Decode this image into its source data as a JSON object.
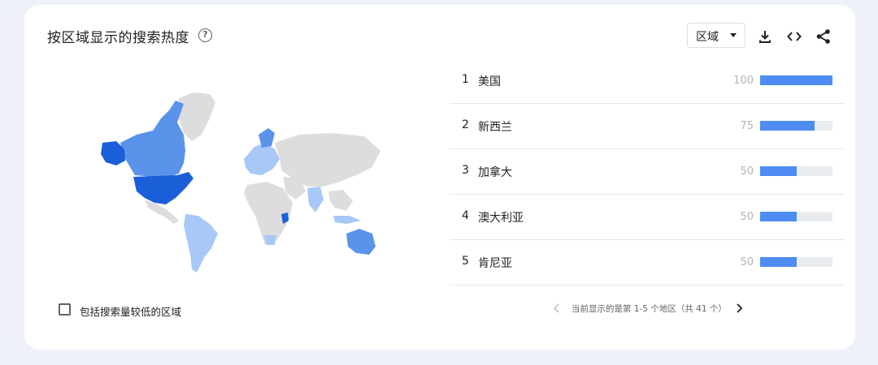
{
  "header": {
    "title": "按区域显示的搜索热度",
    "help_icon": "help-circle-icon",
    "region_select": {
      "value": "区域"
    },
    "tools": [
      "download-icon",
      "embed-code-icon",
      "share-icon"
    ]
  },
  "regions": [
    {
      "rank": "1",
      "name": "美国",
      "value": "100",
      "fraction": 1.0
    },
    {
      "rank": "2",
      "name": "新西兰",
      "value": "75",
      "fraction": 0.75
    },
    {
      "rank": "3",
      "name": "加拿大",
      "value": "50",
      "fraction": 0.5
    },
    {
      "rank": "4",
      "name": "澳大利亚",
      "value": "50",
      "fraction": 0.5
    },
    {
      "rank": "5",
      "name": "肯尼亚",
      "value": "50",
      "fraction": 0.5
    }
  ],
  "checkbox": {
    "label": "包括搜索量较低的区域",
    "checked": false
  },
  "pager": {
    "text": "当前显示的是第 1-5 个地区（共 41 个）"
  },
  "colors": {
    "bar": "#4e8cf2",
    "track": "#e9ecef",
    "map_dark": "#1a5fd8",
    "map_mid": "#5a93ea",
    "map_light": "#a8c8f7",
    "map_gray": "#dddddd"
  }
}
